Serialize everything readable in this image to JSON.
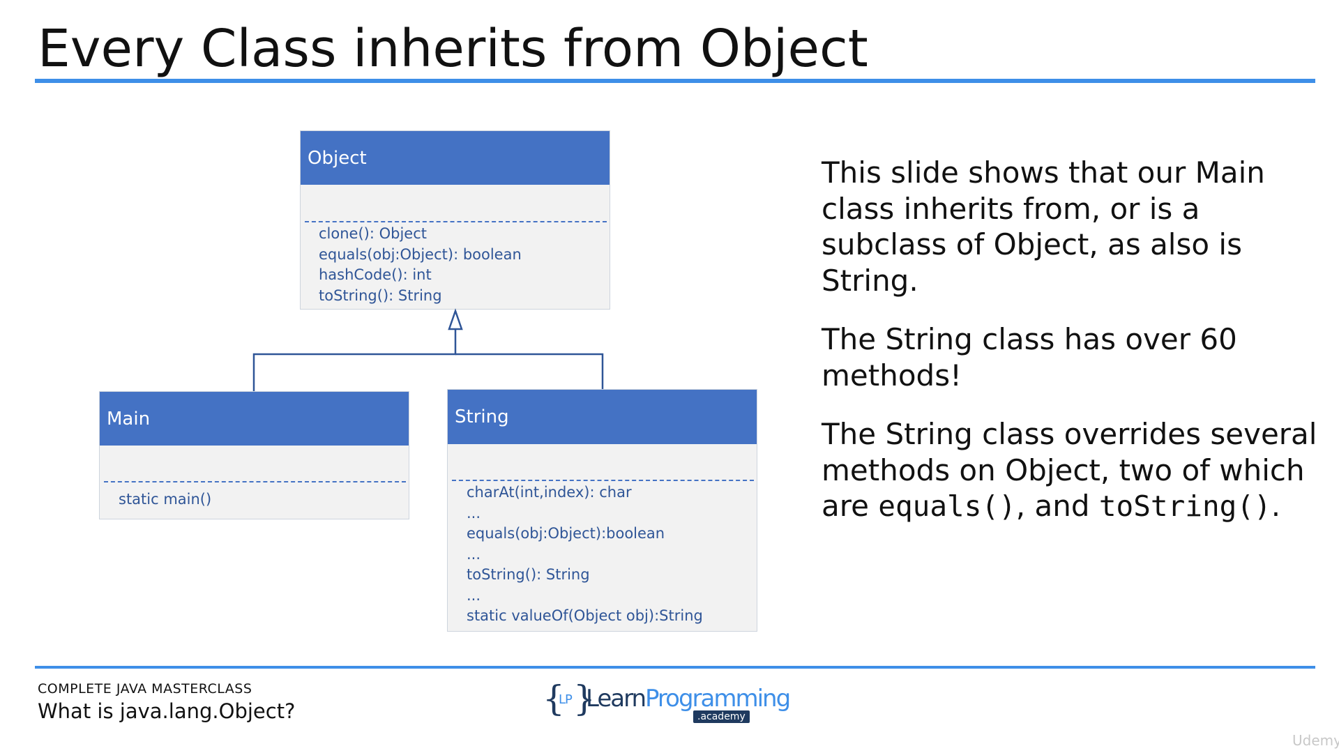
{
  "slide": {
    "title": "Every Class inherits from Object",
    "description": {
      "p1": "This slide shows that our Main class inherits from, or is a subclass of Object, as also is String.",
      "p2": "The String class has over 60 methods!",
      "p3_a": "The String class overrides several methods on Object, two of which are ",
      "p3_code1": "equals()",
      "p3_b": ", and ",
      "p3_code2": "toString()",
      "p3_c": "."
    }
  },
  "diagram": {
    "object_class": {
      "name": "Object",
      "methods": [
        "clone(): Object",
        "equals(obj:Object): boolean",
        "hashCode(): int",
        "toString(): String"
      ]
    },
    "main_class": {
      "name": "Main",
      "methods": [
        "static main()"
      ]
    },
    "string_class": {
      "name": "String",
      "methods": [
        "charAt(int,index): char",
        "...",
        "equals(obj:Object):boolean",
        "...",
        "toString(): String",
        "...",
        "static valueOf(Object obj):String"
      ]
    },
    "line_color": "#2f5597",
    "header_color": "#4472c4"
  },
  "footer": {
    "course": "COMPLETE JAVA MASTERCLASS",
    "lecture": "What is java.lang.Object?",
    "logo": {
      "brace_left": "{",
      "lp": "LP",
      "brace_right": "}",
      "word_learn": "Learn",
      "word_programming": "Programming",
      "badge": ".academy"
    },
    "watermark": "Udemy"
  },
  "colors": {
    "accent_rule": "#3e8fe8",
    "class_header": "#4472c4",
    "method_text": "#2f5597",
    "class_body": "#f2f2f2"
  }
}
